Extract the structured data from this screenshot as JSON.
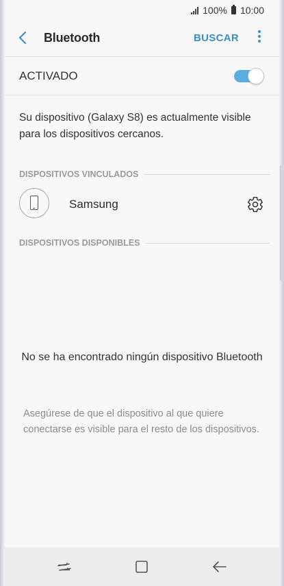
{
  "status_bar": {
    "battery_percent": "100%",
    "time": "10:00"
  },
  "header": {
    "title": "Bluetooth",
    "search_label": "BUSCAR"
  },
  "toggle": {
    "label": "ACTIVADO",
    "on": true,
    "accent_color": "#5aaede"
  },
  "visibility_text": "Su dispositivo (Galaxy S8) es actualmente visible para los dispositivos cercanos.",
  "paired": {
    "header": "DISPOSITIVOS VINCULADOS",
    "devices": [
      {
        "name": "Samsung",
        "icon": "phone-icon"
      }
    ]
  },
  "available": {
    "header": "DISPOSITIVOS DISPONIBLES",
    "empty_title": "No se ha encontrado ningún dispositivo Bluetooth",
    "empty_hint": "Asegúrese de que el dispositivo al que quiere conectarse es visible para el resto de los dispositivos."
  },
  "nav_bar": {
    "icons": [
      "recent-apps-icon",
      "home-icon",
      "back-icon"
    ]
  }
}
